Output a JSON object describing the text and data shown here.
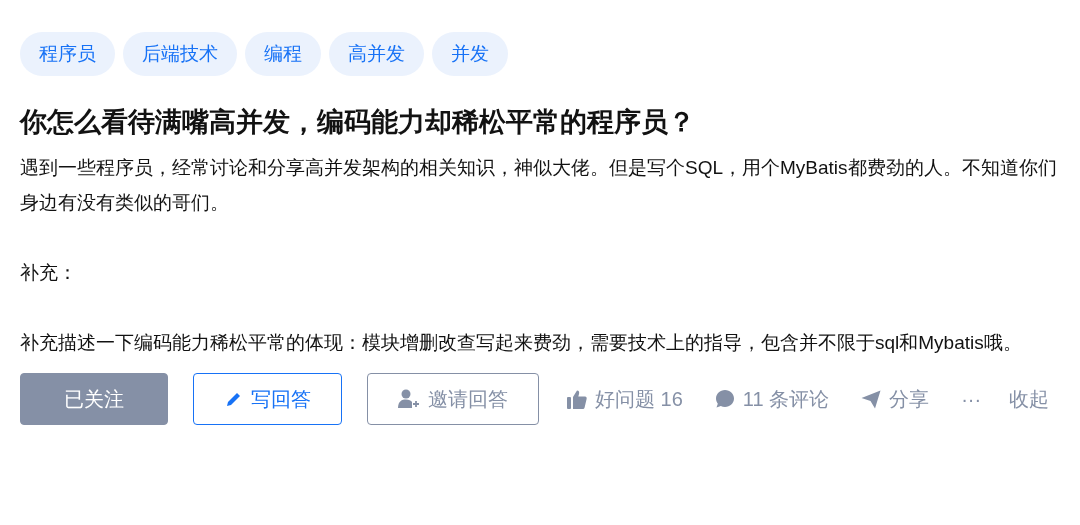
{
  "tags": [
    "程序员",
    "后端技术",
    "编程",
    "高并发",
    "并发"
  ],
  "title": "你怎么看待满嘴高并发，编码能力却稀松平常的程序员？",
  "paragraphs": [
    "遇到一些程序员，经常讨论和分享高并发架构的相关知识，神似大佬。但是写个SQL，用个MyBatis都费劲的人。不知道你们身边有没有类似的哥们。",
    "补充：",
    "补充描述一下编码能力稀松平常的体现：模块增删改查写起来费劲，需要技术上的指导，包含并不限于sql和Mybatis哦。"
  ],
  "follow_button": {
    "label": "已关注",
    "followed": true
  },
  "answer_button": {
    "label": "写回答"
  },
  "invite_button": {
    "label": "邀请回答"
  },
  "actions": [
    {
      "kind": "like",
      "label": "好问题 16"
    },
    {
      "kind": "comment",
      "label": "11 条评论"
    },
    {
      "kind": "share",
      "label": "分享"
    },
    {
      "kind": "more",
      "label": "···"
    },
    {
      "kind": "collapse",
      "label": "收起"
    }
  ]
}
